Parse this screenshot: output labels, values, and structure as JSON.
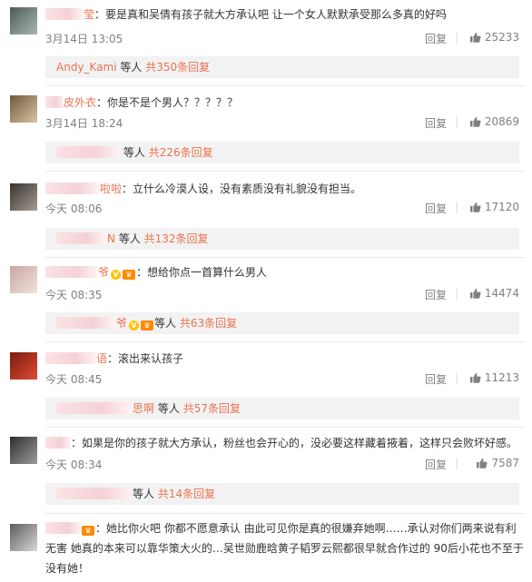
{
  "comments": [
    {
      "user_tail": "莹",
      "text": "：要是真和吴倩有孩子就大方承认吧 让一个女人默默承受那么多真的好吗",
      "time": "3月14日 13:05",
      "reply": "回复",
      "likes": "25233",
      "sub_user": "Andy_Kami",
      "sub_deng": "等人",
      "sub_count": "共350条回复"
    },
    {
      "user_tail": "皮外衣",
      "text": "：你是不是个男人？？？？？",
      "time": "3月14日 18:24",
      "reply": "回复",
      "likes": "20869",
      "sub_user": "",
      "sub_deng": "等人",
      "sub_count": "共226条回复"
    },
    {
      "user_tail": "啦啦",
      "text": "：立什么冷漠人设，没有素质没有礼貌没有担当。",
      "time": "今天 08:06",
      "reply": "回复",
      "likes": "17120",
      "sub_user": "N",
      "sub_deng": "等人",
      "sub_count": "共132条回复"
    },
    {
      "user_tail": "爷",
      "text": "：想给你点一首算什么男人",
      "time": "今天 08:35",
      "reply": "回复",
      "likes": "14474",
      "sub_user": "爷",
      "sub_deng": "等人",
      "sub_count": "共63条回复"
    },
    {
      "user_tail": "语",
      "text": "：滚出来认孩子",
      "time": "今天 08:45",
      "reply": "回复",
      "likes": "11213",
      "sub_user": "思啊",
      "sub_deng": "等人",
      "sub_count": "共57条回复"
    },
    {
      "user_tail": "",
      "text": "：如果是你的孩子就大方承认，粉丝也会开心的，没必要这样藏着掖着，这样只会败坏好感。",
      "time": "今天 08:34",
      "reply": "回复",
      "likes": "7587",
      "sub_user": "",
      "sub_deng": "等人",
      "sub_count": "共14条回复"
    },
    {
      "user_tail": "",
      "text": "：她比你火吧 你都不愿意承认 由此可见你是真的很嫌弃她啊……承认对你们两来说有利无害 她真的本来可以靠华策大火的…吴世勋鹿晗黄子韬罗云熙都很早就合作过的 90后小花也不至于没有她！"
    }
  ],
  "icons": {
    "like": "thumbs-up-icon",
    "verified": "v-badge-icon",
    "member": "crown-icon"
  },
  "colors": {
    "link": "#eb7350",
    "meta": "#808080",
    "subbox": "#f2f2f2"
  }
}
